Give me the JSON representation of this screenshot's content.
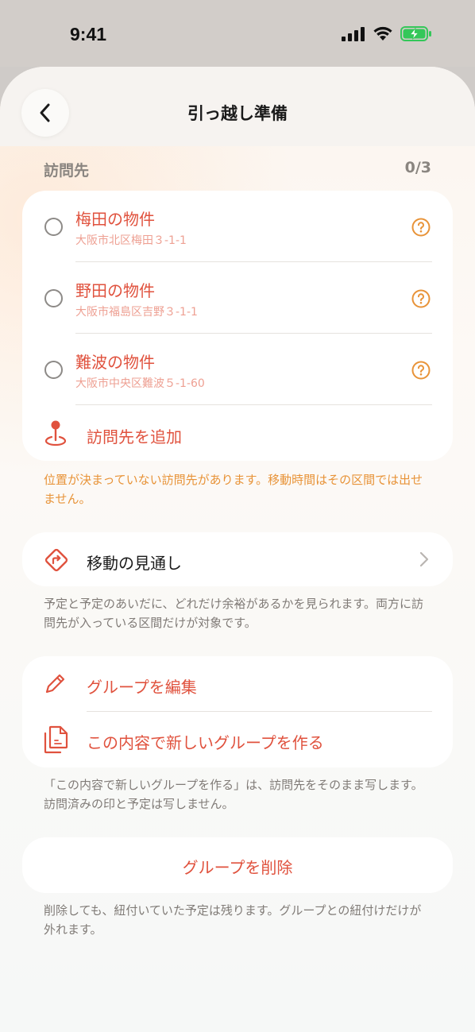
{
  "status": {
    "time": "9:41"
  },
  "nav": {
    "title": "引っ越し準備"
  },
  "visits": {
    "header": "訪問先",
    "count": "0/3",
    "items": [
      {
        "name": "梅田の物件",
        "address": "大阪市北区梅田３-1-1"
      },
      {
        "name": "野田の物件",
        "address": "大阪市福島区吉野３-1-1"
      },
      {
        "name": "難波の物件",
        "address": "大阪市中央区難波５-1-60"
      }
    ],
    "add_label": "訪問先を追加",
    "warning": "位置が決まっていない訪問先があります。移動時間はその区間では出せません。"
  },
  "move": {
    "label": "移動の見通し",
    "note": "予定と予定のあいだに、どれだけ余裕があるかを見られます。両方に訪問先が入っている区間だけが対象です。"
  },
  "group": {
    "edit_label": "グループを編集",
    "duplicate_label": "この内容で新しいグループを作る",
    "note": "「この内容で新しいグループを作る」は、訪問先をそのまま写します。訪問済みの印と予定は写しません。"
  },
  "delete": {
    "label": "グループを削除",
    "note": "削除しても、紐付いていた予定は残ります。グループとの紐付けだけが外れます。"
  },
  "colors": {
    "accent": "#e0523e",
    "warning": "#e89338",
    "battery": "#34c759"
  }
}
